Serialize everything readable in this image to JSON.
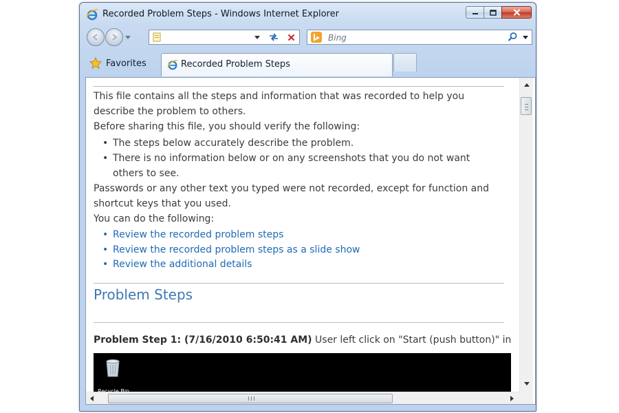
{
  "window": {
    "title": "Recorded Problem Steps - Windows Internet Explorer"
  },
  "nav": {
    "address_value": "",
    "search_placeholder": "Bing"
  },
  "favorites": {
    "label": "Favorites"
  },
  "tabs": [
    {
      "label": "Recorded Problem Steps",
      "active": true
    }
  ],
  "document": {
    "intro": "This file contains all the steps and information that was recorded to help you describe the problem to others.",
    "verify_intro": "Before sharing this file, you should verify the following:",
    "verify_items": [
      "The steps below accurately describe the problem.",
      "There is no information below or on any screenshots that you do not want others to see."
    ],
    "passwords_note": "Passwords or any other text you typed were not recorded, except for function and shortcut keys that you used.",
    "can_do": "You can do the following:",
    "links": [
      "Review the recorded problem steps",
      "Review the recorded problem steps as a slide show",
      "Review the additional details"
    ],
    "heading": "Problem Steps",
    "step1_label": "Problem Step 1: (7/16/2010 6:50:41 AM)",
    "step1_text": " User left click on \"Start (push button)\" in \"Sta",
    "recycle_bin_label": "Recycle Bin"
  },
  "colors": {
    "link": "#1f6ab4",
    "heading": "#3f78b4",
    "close_button": "#c13a24",
    "frame": "#bcd2ee"
  }
}
